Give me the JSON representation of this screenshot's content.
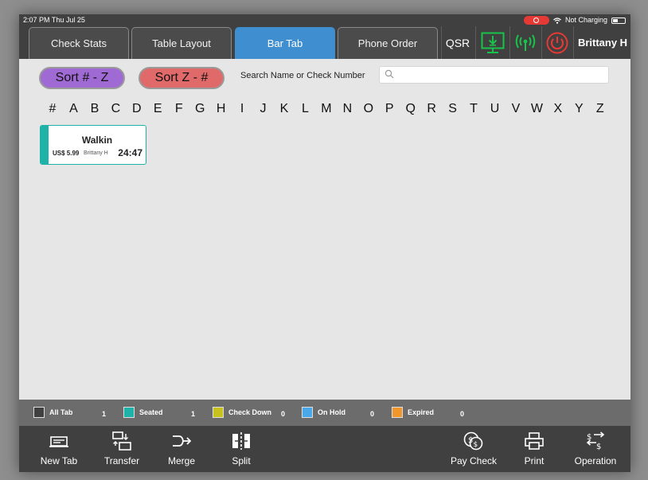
{
  "status_bar": {
    "time": "2:07 PM  Thu Jul 25",
    "battery_text": "Not Charging"
  },
  "top_nav": {
    "tabs": [
      {
        "label": "Check Stats"
      },
      {
        "label": "Table Layout"
      },
      {
        "label": "Bar Tab"
      },
      {
        "label": "Phone Order"
      }
    ],
    "active_tab": "Bar Tab",
    "qsr_label": "QSR",
    "user_name": "Brittany H"
  },
  "controls": {
    "sort_asc_label": "Sort # - Z",
    "sort_desc_label": "Sort Z - #",
    "search_label": "Search Name or Check Number",
    "search_value": "",
    "search_placeholder": ""
  },
  "alphabet": [
    "#",
    "A",
    "B",
    "C",
    "D",
    "E",
    "F",
    "G",
    "H",
    "I",
    "J",
    "K",
    "L",
    "M",
    "N",
    "O",
    "P",
    "Q",
    "R",
    "S",
    "T",
    "U",
    "V",
    "W",
    "X",
    "Y",
    "Z"
  ],
  "checks": [
    {
      "name": "Walkin",
      "amount": "US$ 5.99",
      "server": "Brittany H",
      "elapsed": "24:47",
      "status_color": "#1fb2a8"
    }
  ],
  "legend": [
    {
      "label": "All Tab",
      "count": "1",
      "color": "#404040"
    },
    {
      "label": "Seated",
      "count": "1",
      "color": "#1fb2a8"
    },
    {
      "label": "Check Down",
      "count": "0",
      "color": "#c8c21e"
    },
    {
      "label": "On Hold",
      "count": "0",
      "color": "#4aa8e8"
    },
    {
      "label": "Expired",
      "count": "0",
      "color": "#f0962a"
    }
  ],
  "toolbar": {
    "new_tab": "New Tab",
    "transfer": "Transfer",
    "merge": "Merge",
    "split": "Split",
    "pay_check": "Pay Check",
    "print": "Print",
    "operation": "Operation"
  },
  "colors": {
    "accent": "#3f8fd0",
    "bar_bg": "#404040",
    "canvas": "#e6e6e6"
  }
}
